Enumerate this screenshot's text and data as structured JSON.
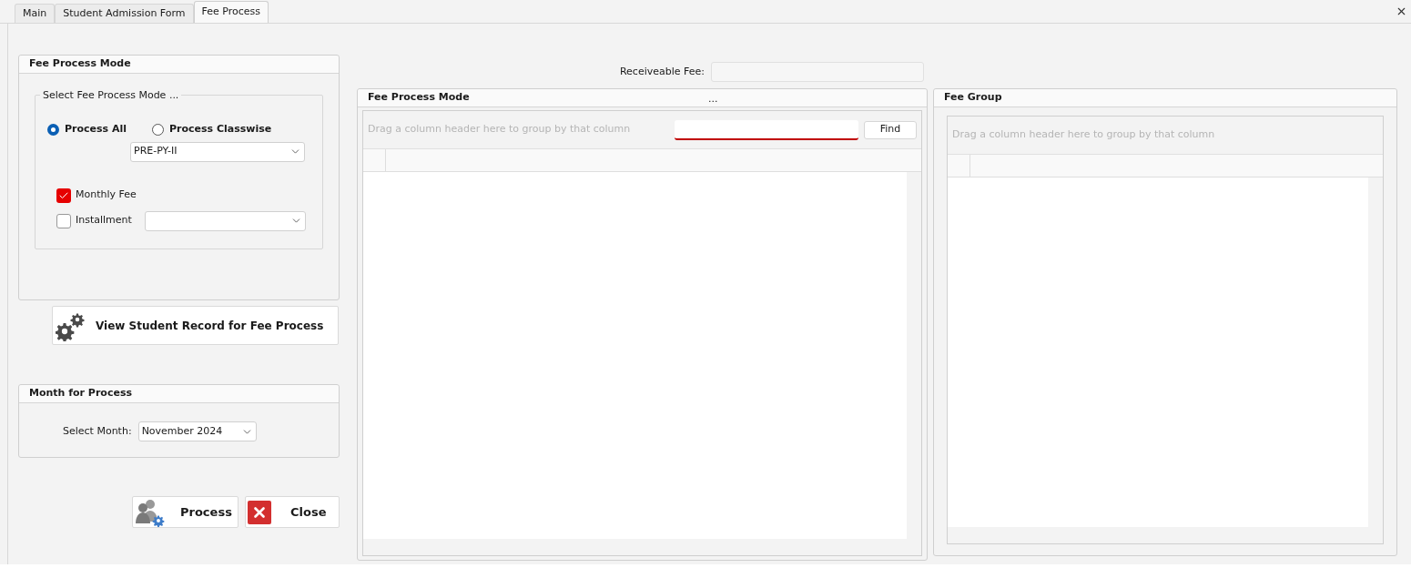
{
  "tabs": [
    {
      "label": "Main",
      "selected": false
    },
    {
      "label": "Student Admission Form",
      "selected": false
    },
    {
      "label": "Fee Process",
      "selected": true
    }
  ],
  "fee_process_mode": {
    "title": "Fee Process Mode",
    "group_title": "Select Fee Process Mode ...",
    "radios": [
      {
        "label": "Process All",
        "selected": true
      },
      {
        "label": "Process Classwise",
        "selected": false
      }
    ],
    "class_dropdown": {
      "value": "PRE-PY-II"
    },
    "checkboxes": [
      {
        "label": "Monthly Fee",
        "checked": true,
        "kind": "plain"
      },
      {
        "label": "Installment",
        "checked": false,
        "kind": "dropdown"
      }
    ]
  },
  "view_button": {
    "label": "View Student Record for Fee Process"
  },
  "month": {
    "title": "Month for Process",
    "label": "Select Month:",
    "value": "November 2024"
  },
  "buttons": [
    {
      "label": "Process",
      "kind": "process"
    },
    {
      "label": "Close",
      "kind": "close"
    }
  ],
  "receivable": {
    "label": "Receiveable Fee:"
  },
  "grids": [
    {
      "title": "Fee Process Mode",
      "header_mark": "...",
      "group_hint": "Drag a column header here to group by that column",
      "find_button": "Find"
    },
    {
      "title": "Fee Group",
      "group_hint": "Drag a column header here to group by that column"
    }
  ]
}
